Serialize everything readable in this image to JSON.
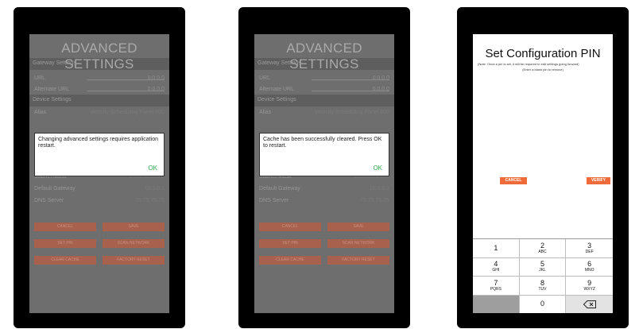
{
  "left_screen": {
    "title": "ADVANCED SETTINGS",
    "gateway_header": "Gateway Settings",
    "url_label": "URL",
    "url_value": "0.0.0.0",
    "alt_url_label": "Alternate URL",
    "alt_url_value": "0.0.0.0",
    "device_header": "Device Settings",
    "alias_label": "Alias",
    "alias_value": "Velocity Scheduling Panel 800",
    "subnet_label": "Subnet Mask",
    "subnet_value": "255.255.255.0",
    "gateway_label": "Default Gateway",
    "gateway_value": "10.0.0.1",
    "dns_label": "DNS Server",
    "dns_value": "75.75.75.75",
    "buttons": [
      "CANCEL",
      "SAVE",
      "SET PIN",
      "SCAN NETWORK",
      "CLEAR CACHE",
      "FACTORY RESET"
    ],
    "dialog_message": "Changing advanced settings requires application restart.",
    "dialog_ok": "OK"
  },
  "middle_screen": {
    "title": "ADVANCED SETTINGS",
    "gateway_header": "Gateway Settings",
    "url_label": "URL",
    "url_value": "0.0.0.0",
    "alt_url_label": "Alternate URL",
    "alt_url_value": "0.0.0.0",
    "device_header": "Device Settings",
    "alias_label": "Alias",
    "alias_value": "Velocity Scheduling Panel 800",
    "subnet_label": "Subnet Mask",
    "subnet_value": "255.255.255.0",
    "gateway_label": "Default Gateway",
    "gateway_value": "10.0.0.1",
    "dns_label": "DNS Server",
    "dns_value": "75.75.75.75",
    "buttons": [
      "CANCEL",
      "SAVE",
      "SET PIN",
      "SCAN NETWORK",
      "CLEAR CACHE",
      "FACTORY RESET"
    ],
    "dialog_message": "Cache has been successfully cleared. Press OK to restart.",
    "dialog_ok": "OK"
  },
  "right_screen": {
    "title": "Set Configuration PIN",
    "note": "(Note: Once a pin is set, it will be required to edit settings going forward)",
    "hint": "(Enter a blank pin to remove)",
    "cancel": "CANCEL",
    "verify": "VERIFY",
    "keys": [
      {
        "num": "1",
        "letters": ""
      },
      {
        "num": "2",
        "letters": "ABC"
      },
      {
        "num": "3",
        "letters": "DEF"
      },
      {
        "num": "4",
        "letters": "GHI"
      },
      {
        "num": "5",
        "letters": "JKL"
      },
      {
        "num": "6",
        "letters": "MNO"
      },
      {
        "num": "7",
        "letters": "PQRS"
      },
      {
        "num": "8",
        "letters": "TUV"
      },
      {
        "num": "9",
        "letters": "WXYZ"
      },
      {
        "num": "",
        "letters": ""
      },
      {
        "num": "0",
        "letters": ""
      },
      {
        "num": "",
        "letters": ""
      }
    ],
    "backspace_icon": "backspace-icon"
  },
  "colors": {
    "orange_button": "#ef6c3a",
    "ok_green": "#2fa84f",
    "dimmed_button": "#a7614c"
  }
}
